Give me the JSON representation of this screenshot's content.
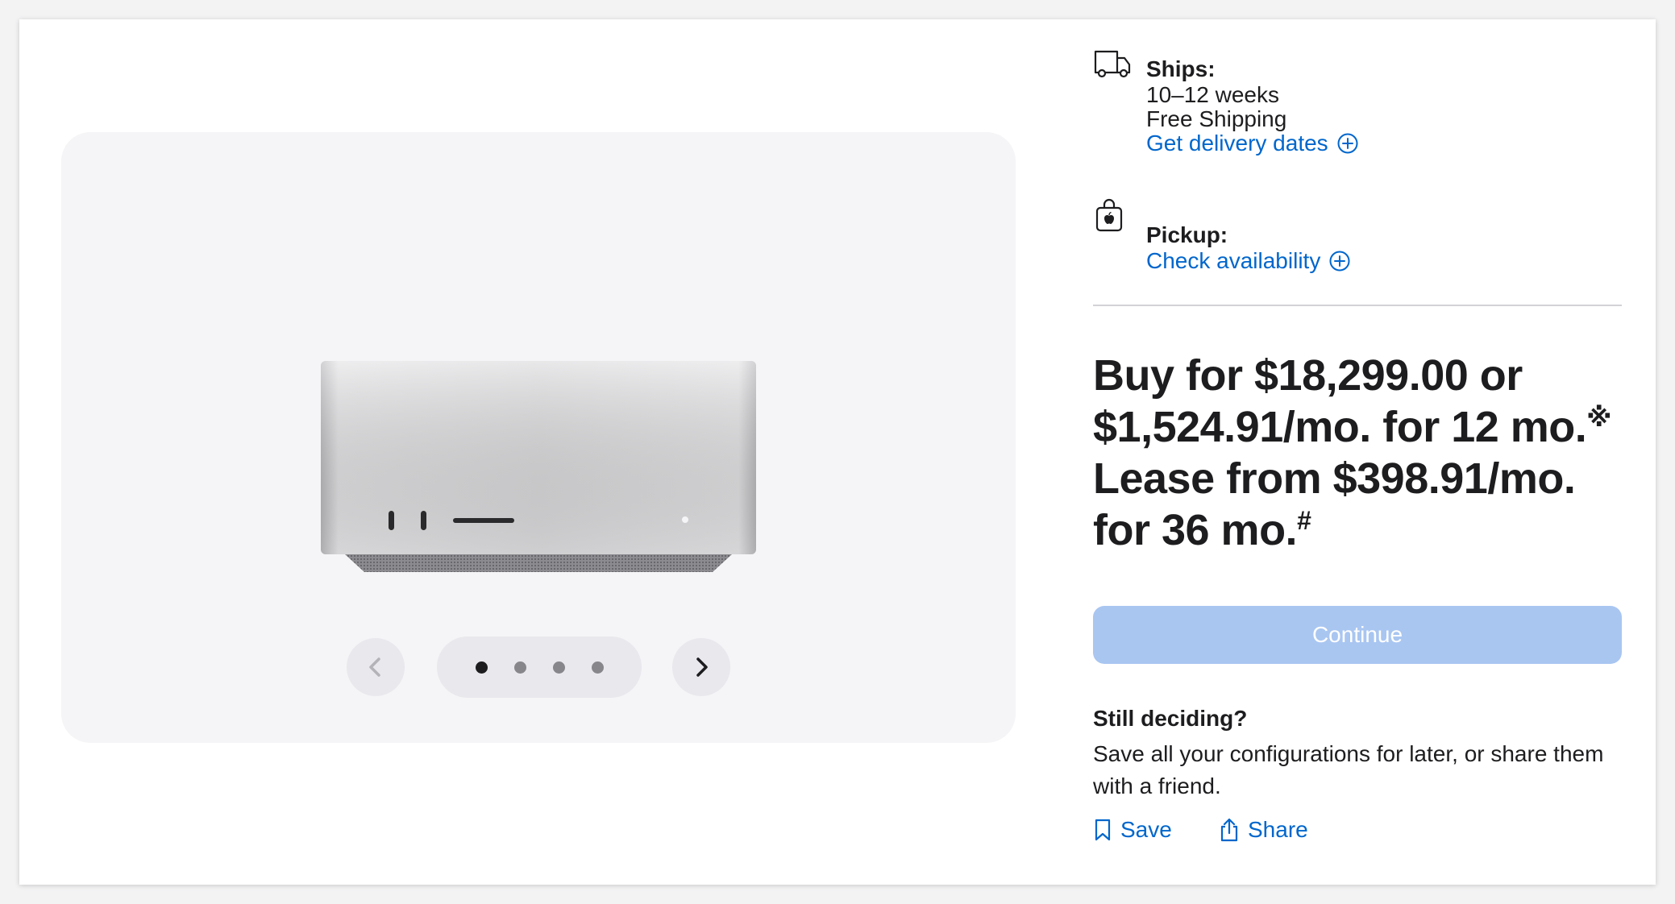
{
  "gallery": {
    "active_index": 1,
    "total": 4,
    "prev_disabled": true
  },
  "shipping": {
    "label": "Ships:",
    "lead_time": "10–12 weeks",
    "shipping_cost": "Free Shipping",
    "delivery_link": "Get delivery dates"
  },
  "pickup": {
    "label": "Pickup:",
    "availability_link": "Check availability"
  },
  "pricing": {
    "buy_prefix": "Buy for ",
    "buy_price": "$18,299.00",
    "or_text": " or",
    "monthly": "$1,524.91/mo. for 12 mo.",
    "monthly_note": "※",
    "lease_text": "Lease from $398.91/mo.",
    "lease_term": "for 36 mo.",
    "lease_note": "#"
  },
  "continue_button": {
    "label": "Continue",
    "disabled": true
  },
  "deciding": {
    "title": "Still deciding?",
    "text": "Save all your configurations for later, or share them with a friend."
  },
  "actions": {
    "save_label": "Save",
    "share_label": "Share"
  },
  "colors": {
    "link": "#0066cc",
    "button_disabled": "#a9c6f1",
    "gallery_bg": "#f5f5f7"
  },
  "icons": {
    "ships": "truck-icon",
    "pickup": "shopping-bag-icon",
    "plus_circle": "plus-circle-icon",
    "save": "bookmark-icon",
    "share": "share-icon",
    "prev": "chevron-left-icon",
    "next": "chevron-right-icon"
  }
}
